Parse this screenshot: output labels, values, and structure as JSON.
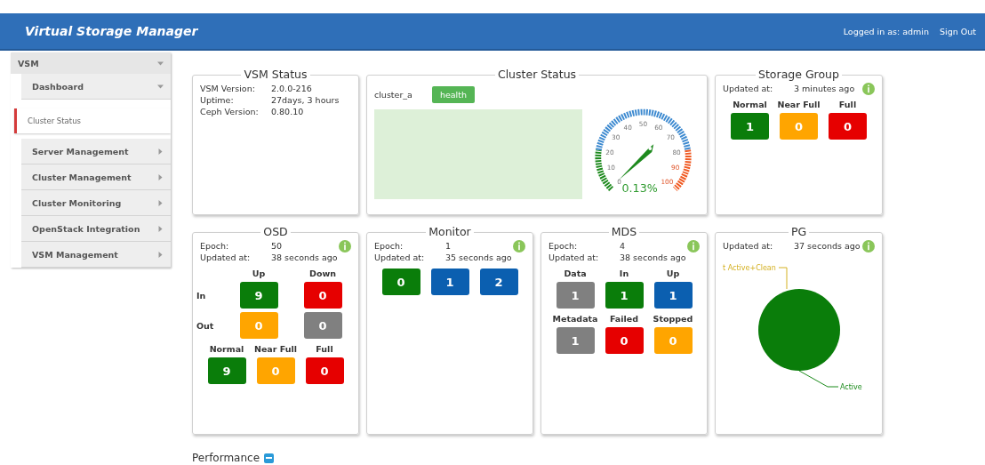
{
  "header": {
    "title": "Virtual Storage Manager",
    "user_label": "Logged in as: admin",
    "sign_out": "Sign Out"
  },
  "sidebar": {
    "items": [
      {
        "label": "VSM",
        "expanded": true,
        "children": [
          {
            "label": "Dashboard",
            "expanded": true,
            "children": [
              {
                "label": "Cluster Status",
                "selected": true
              }
            ]
          },
          {
            "label": "Server Management",
            "expanded": false
          },
          {
            "label": "Cluster Management",
            "expanded": false
          },
          {
            "label": "Cluster Monitoring",
            "expanded": false
          },
          {
            "label": "OpenStack Integration",
            "expanded": false
          },
          {
            "label": "VSM Management",
            "expanded": false
          }
        ]
      }
    ]
  },
  "cards": [
    {
      "kind": "info",
      "title": "VSM Status",
      "fields": [
        {
          "label": "VSM Version:",
          "value": "2.0.0-216"
        },
        {
          "label": "Uptime:",
          "value": "27days, 3 hours"
        },
        {
          "label": "Ceph Version:",
          "value": "0.80.10"
        }
      ]
    },
    {
      "kind": "cluster",
      "title": "Cluster Status",
      "cluster_name": "cluster_a",
      "badge": "health",
      "gauge": {
        "ticks": [
          "0",
          "10",
          "20",
          "30",
          "40",
          "50",
          "60",
          "70",
          "80",
          "90",
          "100"
        ],
        "reading": "0.13%"
      }
    },
    {
      "kind": "tiles",
      "title": "Storage Group",
      "fields": [
        {
          "label": "Updated at:",
          "value": "3 minutes ago"
        }
      ],
      "ok": true,
      "sections": [
        {
          "headers": [
            "Normal",
            "Near Full",
            "Full"
          ],
          "rows": [
            {
              "tiles": [
                {
                  "value": "1",
                  "color": "#0a7d0a"
                },
                {
                  "value": "0",
                  "color": "#ffa500"
                },
                {
                  "value": "0",
                  "color": "#e60000"
                }
              ]
            }
          ]
        }
      ]
    },
    {
      "kind": "tiles",
      "title": "OSD",
      "fields": [
        {
          "label": "Epoch:",
          "value": "50"
        },
        {
          "label": "Updated at:",
          "value": "38 seconds ago"
        }
      ],
      "ok": true,
      "sections": [
        {
          "headers": [
            "Up",
            "Down"
          ],
          "rows": [
            {
              "label": "In",
              "tiles": [
                {
                  "value": "9",
                  "color": "#0a7d0a"
                },
                {
                  "value": "0",
                  "color": "#e60000"
                }
              ]
            },
            {
              "label": "Out",
              "tiles": [
                {
                  "value": "0",
                  "color": "#ffa500"
                },
                {
                  "value": "0",
                  "color": "#808080"
                }
              ]
            }
          ]
        },
        {
          "headers": [
            "Normal",
            "Near Full",
            "Full"
          ],
          "rows": [
            {
              "tiles": [
                {
                  "value": "9",
                  "color": "#0a7d0a"
                },
                {
                  "value": "0",
                  "color": "#ffa500"
                },
                {
                  "value": "0",
                  "color": "#e60000"
                }
              ]
            }
          ]
        }
      ]
    },
    {
      "kind": "tiles",
      "title": "Monitor",
      "fields": [
        {
          "label": "Epoch:",
          "value": "1"
        },
        {
          "label": "Updated at:",
          "value": "35 seconds ago"
        }
      ],
      "ok": true,
      "sections": [
        {
          "rows": [
            {
              "tiles": [
                {
                  "value": "0",
                  "color": "#0a7d0a"
                },
                {
                  "value": "1",
                  "color": "#0b5fb0"
                },
                {
                  "value": "2",
                  "color": "#0b5fb0"
                }
              ]
            }
          ]
        }
      ]
    },
    {
      "kind": "tiles",
      "title": "MDS",
      "fields": [
        {
          "label": "Epoch:",
          "value": "4"
        },
        {
          "label": "Updated at:",
          "value": "38 seconds ago"
        }
      ],
      "ok": true,
      "sections": [
        {
          "headers": [
            "Data",
            "In",
            "Up"
          ],
          "rows": [
            {
              "tiles": [
                {
                  "value": "1",
                  "color": "#808080"
                },
                {
                  "value": "1",
                  "color": "#0a7d0a"
                },
                {
                  "value": "1",
                  "color": "#0b5fb0"
                }
              ]
            }
          ]
        },
        {
          "headers": [
            "Metadata",
            "Failed",
            "Stopped"
          ],
          "rows": [
            {
              "tiles": [
                {
                  "value": "1",
                  "color": "#808080"
                },
                {
                  "value": "0",
                  "color": "#e60000"
                },
                {
                  "value": "0",
                  "color": "#ffa500"
                }
              ]
            }
          ]
        }
      ]
    },
    {
      "kind": "pie",
      "title": "PG",
      "fields": [
        {
          "label": "Updated at:",
          "value": "37 seconds ago"
        }
      ],
      "ok": true,
      "labels": [
        "t Active+Clean",
        "Active"
      ]
    }
  ],
  "performance": {
    "title": "Performance",
    "expanded": true
  }
}
